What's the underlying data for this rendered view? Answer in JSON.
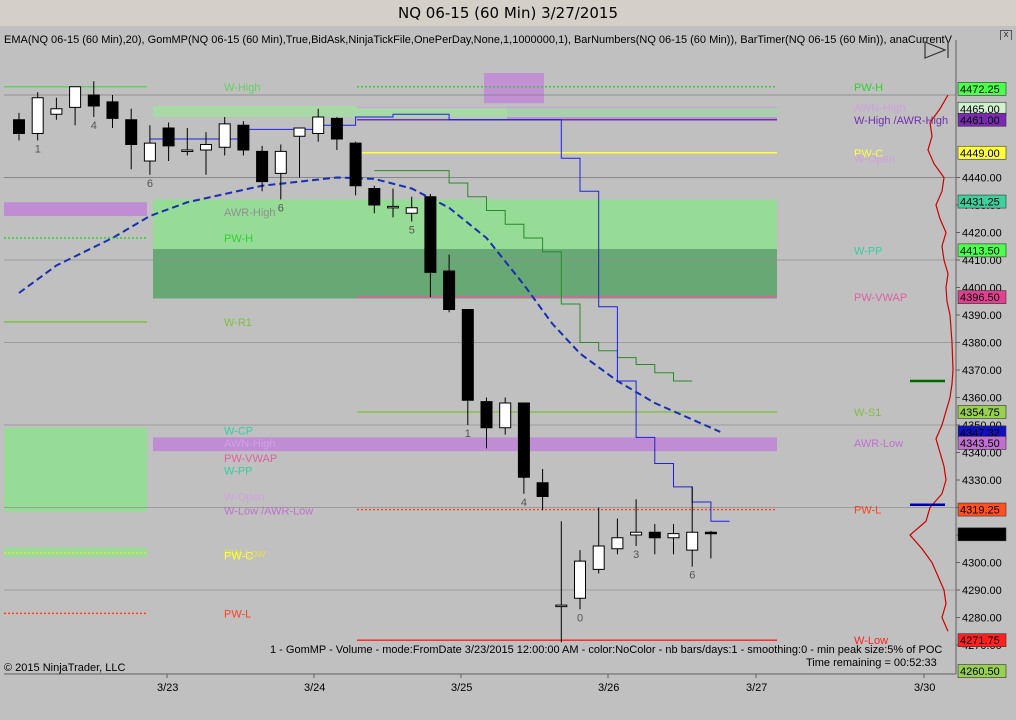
{
  "window": {
    "title": "NQ 06-15 (60 Min)  3/27/2015",
    "close_glyph": "x"
  },
  "header": {
    "indicator_line": "EMA(NQ 06-15 (60 Min),20), GomMP(NQ 06-15 (60 Min),True,BidAsk,NinjaTickFile,OnePerDay,None,1,1000000,1), BarNumbers(NQ 06-15 (60 Min)), BarTimer(NQ 06-15 (60 Min)), anaCurrentV"
  },
  "footer": {
    "gom_info": "1 - GomMP - Volume - mode:FromDate 3/23/2015 12:00:00 AM - color:NoColor - nb bars/days:1 - smoothing:0 - min peak size:5% of POC",
    "time_remaining": "Time remaining = 00:52:33",
    "copyright": "© 2015 NinjaTrader, LLC"
  },
  "colors": {
    "background": "#c0c0c0",
    "green_zone": "#8ee08e",
    "dark_green_zone": "#5f9f6f",
    "purple_zone": "#c084d8",
    "ema": "#1a2fb0",
    "blue_step": "#2020dd",
    "green_step": "#2a8a2a"
  },
  "chart_data": {
    "type": "candlestick",
    "title": "NQ 06-15 (60 Min)  3/27/2015",
    "ylim": [
      4255,
      4478
    ],
    "y_ticks": [
      4270,
      4280,
      4290,
      4300,
      4310,
      4320,
      4330,
      4340,
      4350,
      4360,
      4370,
      4380,
      4390,
      4400,
      4410,
      4420,
      4430,
      4440
    ],
    "x_ticks": [
      "3/23",
      "3/24",
      "3/25",
      "3/26",
      "3/27",
      "3/30"
    ],
    "candles": [
      [
        4461.0,
        4463.5,
        4453.5,
        4456.0
      ],
      [
        4456.0,
        4471.0,
        4453.5,
        4469.0
      ],
      [
        4463.0,
        4469.0,
        4461.0,
        4465.0
      ],
      [
        4465.5,
        4473.0,
        4459.0,
        4473.0
      ],
      [
        4470.0,
        4475.0,
        4462.0,
        4466.0
      ],
      [
        4467.5,
        4470.0,
        4458.0,
        4461.5
      ],
      [
        4461.0,
        4465.0,
        4443.0,
        4452.0
      ],
      [
        4446.0,
        4459.0,
        4441.0,
        4452.5
      ],
      [
        4458.0,
        4460.0,
        4446.0,
        4451.5
      ],
      [
        4450.0,
        4458.0,
        4448.0,
        4450.0
      ],
      [
        4450.0,
        4456.5,
        4441.0,
        4452.0
      ],
      [
        4451.0,
        4462.0,
        4448.0,
        4459.5
      ],
      [
        4459.0,
        4460.5,
        4448.0,
        4450.0
      ],
      [
        4449.5,
        4451.5,
        4435.0,
        4438.5
      ],
      [
        4441.5,
        4452.0,
        4432.0,
        4449.5
      ],
      [
        4455.0,
        4457.0,
        4440.0,
        4458.0
      ],
      [
        4456.0,
        4465.0,
        4453.0,
        4462.0
      ],
      [
        4461.5,
        4462.0,
        4450.0,
        4454.0
      ],
      [
        4452.5,
        4453.0,
        4433.5,
        4437.0
      ],
      [
        4436.0,
        4437.0,
        4427.0,
        4430.0
      ],
      [
        4429.0,
        4436.0,
        4425.5,
        4429.5
      ],
      [
        4427.0,
        4433.0,
        4424.0,
        4429.0
      ],
      [
        4433.0,
        4434.0,
        4396.5,
        4405.5
      ],
      [
        4406.0,
        4412.0,
        4391.0,
        4392.0
      ],
      [
        4392.0,
        4392.0,
        4350.0,
        4359.0
      ],
      [
        4358.5,
        4360.0,
        4341.5,
        4349.0
      ],
      [
        4349.0,
        4360.0,
        4346.5,
        4358.0
      ],
      [
        4358.0,
        4358.0,
        4325.0,
        4331.0
      ],
      [
        4329.0,
        4334.0,
        4319.0,
        4324.0
      ],
      [
        4284.5,
        4315.0,
        4271.0,
        4284.5
      ],
      [
        4287.0,
        4304.5,
        4283.0,
        4300.5
      ],
      [
        4297.5,
        4320.0,
        4296.0,
        4306.0
      ],
      [
        4305.0,
        4316.0,
        4303.0,
        4309.0
      ],
      [
        4310.0,
        4323.0,
        4306.0,
        4311.0
      ],
      [
        4311.0,
        4314.0,
        4303.0,
        4309.0
      ],
      [
        4309.0,
        4314.0,
        4303.0,
        4310.5
      ],
      [
        4304.5,
        4327.5,
        4298.5,
        4311.0
      ],
      [
        4311.0,
        4311.5,
        4301.5,
        4310.5
      ]
    ],
    "bar_numbers": [
      {
        "bar": 1,
        "label": "1"
      },
      {
        "bar": 4,
        "label": "4"
      },
      {
        "bar": 7,
        "label": "6"
      },
      {
        "bar": 14,
        "label": "6"
      },
      {
        "bar": 21,
        "label": "5"
      },
      {
        "bar": 24,
        "label": "1"
      },
      {
        "bar": 27,
        "label": "4"
      },
      {
        "bar": 30,
        "label": "0"
      },
      {
        "bar": 33,
        "label": "3"
      },
      {
        "bar": 36,
        "label": "6"
      }
    ],
    "ema20": [
      [
        4398.0,
        0
      ],
      [
        4408.0,
        2
      ],
      [
        4418.0,
        5
      ],
      [
        4426.0,
        7
      ],
      [
        4431.0,
        9
      ],
      [
        4434.0,
        11
      ],
      [
        4437.0,
        13
      ],
      [
        4438.5,
        15
      ],
      [
        4440.0,
        17
      ],
      [
        4439.5,
        19
      ],
      [
        4436.0,
        21
      ],
      [
        4429.0,
        23
      ],
      [
        4418.0,
        25
      ],
      [
        4401.0,
        27
      ],
      [
        4387.0,
        28.5
      ],
      [
        4376.0,
        30
      ],
      [
        4366.0,
        32
      ],
      [
        4358.0,
        34
      ],
      [
        4352.0,
        36
      ],
      [
        4347.5,
        37.5
      ]
    ],
    "blue_step": [
      [
        4454.0,
        7,
        12
      ],
      [
        4457.5,
        12,
        16
      ],
      [
        4459.0,
        16,
        18
      ],
      [
        4462.0,
        18,
        20
      ],
      [
        4463.0,
        20,
        23
      ],
      [
        4461.0,
        23,
        29
      ],
      [
        4447.0,
        29,
        30
      ],
      [
        4435.0,
        30,
        31
      ],
      [
        4393.0,
        31,
        32
      ],
      [
        4366.0,
        32,
        33
      ],
      [
        4345.5,
        33,
        34
      ],
      [
        4336.0,
        34,
        35
      ],
      [
        4327.5,
        35,
        36
      ],
      [
        4322.0,
        36,
        37
      ],
      [
        4315.0,
        37,
        38
      ]
    ],
    "green_step": [
      [
        4442.5,
        19,
        23
      ],
      [
        4438.0,
        23,
        24
      ],
      [
        4433.0,
        24,
        25
      ],
      [
        4428.0,
        25,
        26
      ],
      [
        4423.0,
        26,
        27
      ],
      [
        4418.0,
        27,
        28
      ],
      [
        4413.0,
        28,
        29
      ],
      [
        4394.0,
        29,
        30
      ],
      [
        4380.0,
        30,
        31
      ],
      [
        4377.0,
        31,
        32
      ],
      [
        4374.5,
        32,
        33
      ],
      [
        4372.0,
        33,
        34
      ],
      [
        4369.0,
        34,
        35
      ],
      [
        4366.0,
        35,
        36
      ]
    ],
    "levels_left": [
      {
        "label": "W-High",
        "price": 4473.0,
        "color": "#5fd35f",
        "style": "solid",
        "day": 0
      },
      {
        "label": "AWR-High",
        "price": 4427.5,
        "color": "#909090",
        "style": "none",
        "day": 1
      },
      {
        "label": "PW-H",
        "price": 4418.0,
        "color": "#2fd22f",
        "style": "dotted",
        "day": 0
      },
      {
        "label": "W-R1",
        "price": 4387.5,
        "color": "#7fbf3f",
        "style": "solid",
        "day": 0
      },
      {
        "label": "W-CP",
        "price": 4348.0,
        "color": "#30d0a0",
        "style": "none",
        "day": 1
      },
      {
        "label": "AWN-High",
        "price": 4343.5,
        "color": "#d0a0e0",
        "style": "none",
        "day": 1
      },
      {
        "label": "PW-VWAP",
        "price": 4338.0,
        "color": "#e060a0",
        "style": "none",
        "day": 1
      },
      {
        "label": "W-PP",
        "price": 4333.5,
        "color": "#30d0a0",
        "style": "none",
        "day": 1
      },
      {
        "label": "W-Open",
        "price": 4324.0,
        "color": "#d0a0e0",
        "style": "none",
        "day": 1
      },
      {
        "label": "W-Low /AWR-Low",
        "price": 4319.0,
        "color": "#c070d0",
        "style": "none",
        "day": 1
      },
      {
        "label": "PW-Low",
        "price": 4303.5,
        "color": "#e0e050",
        "style": "dotted",
        "day": 0
      },
      {
        "label": "PW-C",
        "price": 4302.5,
        "color": "#ffff40",
        "style": "none",
        "day": 1
      },
      {
        "label": "PW-L",
        "price": 4281.5,
        "color": "#ff4020",
        "style": "dotted",
        "day": 0
      }
    ],
    "levels_right": [
      {
        "label": "PW-H",
        "price": 4473.0,
        "color": "#2fd22f",
        "style": "dotted"
      },
      {
        "label": "AWN-High",
        "price": 4465.5,
        "color": "#d0a0e0",
        "style": "solid"
      },
      {
        "label": "W-High /AWR-High",
        "price": 4461.0,
        "color": "#7030b0",
        "style": "solid"
      },
      {
        "label": "PW-C",
        "price": 4449.0,
        "color": "#ffff40",
        "style": "solid"
      },
      {
        "label": "W-Open",
        "price": 4447.0,
        "color": "#d0a0e0",
        "style": "none"
      },
      {
        "label": "W-PP",
        "price": 4413.5,
        "color": "#30d0a0",
        "style": "none"
      },
      {
        "label": "PW-VWAP",
        "price": 4396.5,
        "color": "#e060a0",
        "style": "solid"
      },
      {
        "label": "W-S1",
        "price": 4354.75,
        "color": "#7fbf3f",
        "style": "solid"
      },
      {
        "label": "AWR-Low",
        "price": 4343.5,
        "color": "#c070d0",
        "style": "none"
      },
      {
        "label": "PW-L",
        "price": 4319.25,
        "color": "#ff4020",
        "style": "dotted"
      },
      {
        "label": "W-Low",
        "price": 4271.75,
        "color": "#ff2020",
        "style": "solid"
      }
    ],
    "zones": [
      {
        "name": "green-zone-left",
        "price_top": 4349.0,
        "price_bottom": 4318.5,
        "color": "#8ee08e",
        "day": 0
      },
      {
        "name": "green-zone-main",
        "price_top": 4432.0,
        "price_bottom": 4396.0,
        "color": "#8ee08e",
        "day": 1
      },
      {
        "name": "dark-green-zone",
        "price_top": 4414.0,
        "price_bottom": 4396.0,
        "color": "#5f9f6f",
        "day": 1
      },
      {
        "name": "purple-zone-left",
        "price_top": 4431.0,
        "price_bottom": 4426.0,
        "color": "#c084d8",
        "day": 0
      },
      {
        "name": "purple-zone-low",
        "price_top": 4345.5,
        "price_bottom": 4340.5,
        "color": "#c084d8",
        "day": 1
      },
      {
        "name": "green-band-left",
        "price_top": 4305.5,
        "price_bottom": 4302.0,
        "color": "#90e090",
        "day": 0
      }
    ],
    "price_labels": [
      {
        "text": "4472.25",
        "price": 4472.25,
        "bg": "#4cff4c",
        "fg": "#000000"
      },
      {
        "text": "4465.00",
        "price": 4465.0,
        "bg": "#d0f0d0",
        "fg": "#000000"
      },
      {
        "text": "4461.00",
        "price": 4461.0,
        "bg": "#7a2ab0",
        "fg": "#ffffff"
      },
      {
        "text": "4449.00",
        "price": 4449.0,
        "bg": "#ffff40",
        "fg": "#000000"
      },
      {
        "text": "4431.25",
        "price": 4431.25,
        "bg": "#40d0a0",
        "fg": "#000000"
      },
      {
        "text": "4413.50",
        "price": 4413.5,
        "bg": "#4cff4c",
        "fg": "#000000"
      },
      {
        "text": "4396.50",
        "price": 4396.5,
        "bg": "#e04090",
        "fg": "#ffffff"
      },
      {
        "text": "4354.75",
        "price": 4354.75,
        "bg": "#9ad050",
        "fg": "#000000"
      },
      {
        "text": "4347.32",
        "price": 4347.32,
        "bg": "#1010c0",
        "fg": "#ffffff"
      },
      {
        "text": "4343.50",
        "price": 4343.5,
        "bg": "#c070d0",
        "fg": "#000000"
      },
      {
        "text": "4319.25",
        "price": 4319.25,
        "bg": "#ff5020",
        "fg": "#000000"
      },
      {
        "text": "4310.25",
        "price": 4310.25,
        "bg": "#000000",
        "fg": "#ffffff"
      },
      {
        "text": "4271.75",
        "price": 4271.75,
        "bg": "#ff2020",
        "fg": "#ffffff"
      },
      {
        "text": "4260.50",
        "price": 4260.5,
        "bg": "#9ad050",
        "fg": "#000000"
      }
    ],
    "volume_profile": [
      [
        4275,
        8
      ],
      [
        4280,
        14
      ],
      [
        4285,
        10
      ],
      [
        4290,
        12
      ],
      [
        4295,
        18
      ],
      [
        4300,
        24
      ],
      [
        4305,
        34
      ],
      [
        4310,
        46
      ],
      [
        4315,
        30
      ],
      [
        4320,
        26
      ],
      [
        4325,
        14
      ],
      [
        4330,
        10
      ],
      [
        4335,
        12
      ],
      [
        4340,
        16
      ],
      [
        4345,
        20
      ],
      [
        4350,
        14
      ],
      [
        4355,
        10
      ],
      [
        4360,
        6
      ],
      [
        4365,
        4
      ],
      [
        4370,
        3
      ],
      [
        4380,
        4
      ],
      [
        4390,
        6
      ],
      [
        4395,
        9
      ],
      [
        4400,
        10
      ],
      [
        4405,
        8
      ],
      [
        4410,
        12
      ],
      [
        4415,
        14
      ],
      [
        4420,
        10
      ],
      [
        4425,
        16
      ],
      [
        4430,
        20
      ],
      [
        4435,
        14
      ],
      [
        4440,
        12
      ],
      [
        4445,
        22
      ],
      [
        4450,
        28
      ],
      [
        4455,
        24
      ],
      [
        4460,
        26
      ],
      [
        4465,
        16
      ],
      [
        4470,
        8
      ]
    ]
  }
}
